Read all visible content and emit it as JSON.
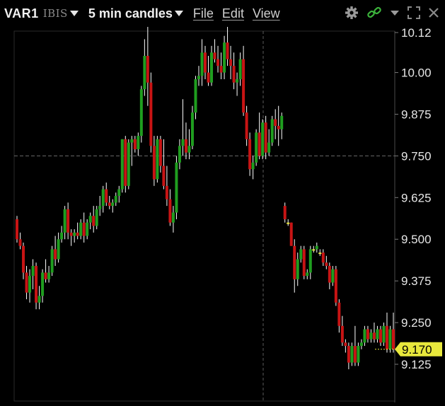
{
  "header": {
    "symbol": "VAR1",
    "exchange": "IBIS",
    "interval_label": "5 min candles",
    "menu": [
      "File",
      "Edit",
      "View"
    ]
  },
  "toolbar_icons": [
    "gear-icon",
    "link-icon",
    "dropdown-caret-icon",
    "expand-icon",
    "close-icon"
  ],
  "colors": {
    "background": "#000000",
    "up": "#1f9e1f",
    "down": "#c81414",
    "wick": "#ffffff",
    "last_price_badge": "#e8e83c",
    "accent_link": "#3cb43c"
  },
  "chart_data": {
    "type": "candlestick",
    "y_ticks": [
      "10.12",
      "10.00",
      "9.875",
      "9.750",
      "9.625",
      "9.500",
      "9.375",
      "9.250",
      "9.125"
    ],
    "ylim": [
      9.1,
      10.18
    ],
    "last_price": "9.170",
    "crosshair_price": 9.75,
    "candles": [
      [
        9.56,
        9.57,
        9.49,
        9.5
      ],
      [
        9.5,
        9.52,
        9.47,
        9.48
      ],
      [
        9.48,
        9.49,
        9.38,
        9.4
      ],
      [
        9.4,
        9.42,
        9.32,
        9.34
      ],
      [
        9.34,
        9.41,
        9.31,
        9.39
      ],
      [
        9.39,
        9.44,
        9.35,
        9.42
      ],
      [
        9.42,
        9.43,
        9.29,
        9.31
      ],
      [
        9.31,
        9.36,
        9.29,
        9.33
      ],
      [
        9.33,
        9.41,
        9.31,
        9.4
      ],
      [
        9.4,
        9.44,
        9.37,
        9.38
      ],
      [
        9.38,
        9.42,
        9.37,
        9.4
      ],
      [
        9.4,
        9.48,
        9.39,
        9.47
      ],
      [
        9.47,
        9.51,
        9.42,
        9.44
      ],
      [
        9.44,
        9.52,
        9.43,
        9.5
      ],
      [
        9.5,
        9.54,
        9.49,
        9.52
      ],
      [
        9.52,
        9.6,
        9.5,
        9.59
      ],
      [
        9.59,
        9.61,
        9.5,
        9.52
      ],
      [
        9.52,
        9.53,
        9.48,
        9.51
      ],
      [
        9.51,
        9.53,
        9.49,
        9.52
      ],
      [
        9.52,
        9.55,
        9.5,
        9.51
      ],
      [
        9.51,
        9.56,
        9.5,
        9.55
      ],
      [
        9.55,
        9.58,
        9.49,
        9.51
      ],
      [
        9.51,
        9.56,
        9.5,
        9.55
      ],
      [
        9.55,
        9.58,
        9.53,
        9.57
      ],
      [
        9.57,
        9.6,
        9.52,
        9.54
      ],
      [
        9.54,
        9.6,
        9.53,
        9.59
      ],
      [
        9.59,
        9.63,
        9.57,
        9.6
      ],
      [
        9.6,
        9.66,
        9.58,
        9.65
      ],
      [
        9.65,
        9.67,
        9.6,
        9.61
      ],
      [
        9.61,
        9.63,
        9.59,
        9.6
      ],
      [
        9.6,
        9.62,
        9.58,
        9.61
      ],
      [
        9.61,
        9.64,
        9.6,
        9.63
      ],
      [
        9.63,
        9.66,
        9.61,
        9.65
      ],
      [
        9.65,
        9.8,
        9.64,
        9.8
      ],
      [
        9.8,
        9.81,
        9.64,
        9.66
      ],
      [
        9.66,
        9.8,
        9.65,
        9.79
      ],
      [
        9.79,
        9.81,
        9.72,
        9.8
      ],
      [
        9.8,
        9.81,
        9.76,
        9.77
      ],
      [
        9.77,
        9.82,
        9.75,
        9.81
      ],
      [
        9.81,
        9.96,
        9.79,
        9.95
      ],
      [
        9.95,
        10.1,
        9.93,
        10.05
      ],
      [
        10.05,
        10.15,
        9.9,
        9.97
      ],
      [
        9.97,
        10.0,
        9.76,
        9.78
      ],
      [
        9.78,
        9.81,
        9.66,
        9.68
      ],
      [
        9.68,
        9.81,
        9.67,
        9.8
      ],
      [
        9.8,
        9.81,
        9.7,
        9.72
      ],
      [
        9.72,
        9.8,
        9.65,
        9.66
      ],
      [
        9.66,
        9.72,
        9.6,
        9.62
      ],
      [
        9.62,
        9.65,
        9.54,
        9.55
      ],
      [
        9.55,
        9.6,
        9.52,
        9.58
      ],
      [
        9.58,
        9.75,
        9.56,
        9.73
      ],
      [
        9.73,
        9.8,
        9.71,
        9.78
      ],
      [
        9.78,
        9.92,
        9.75,
        9.8
      ],
      [
        9.8,
        9.85,
        9.74,
        9.76
      ],
      [
        9.76,
        9.83,
        9.74,
        9.78
      ],
      [
        9.78,
        9.9,
        9.77,
        9.88
      ],
      [
        9.88,
        9.99,
        9.86,
        9.98
      ],
      [
        9.98,
        10.02,
        9.96,
        9.99
      ],
      [
        9.99,
        10.1,
        9.96,
        10.06
      ],
      [
        10.06,
        10.08,
        9.98,
        10.0
      ],
      [
        10.0,
        10.05,
        9.96,
        9.97
      ],
      [
        9.97,
        10.08,
        9.96,
        10.06
      ],
      [
        10.06,
        10.1,
        10.03,
        10.04
      ],
      [
        10.04,
        10.08,
        10.0,
        10.02
      ],
      [
        10.02,
        10.06,
        9.98,
        10.0
      ],
      [
        10.0,
        10.11,
        9.98,
        10.09
      ],
      [
        10.09,
        10.14,
        10.02,
        10.04
      ],
      [
        10.04,
        10.08,
        9.98,
        10.02
      ],
      [
        10.02,
        10.06,
        9.95,
        9.97
      ],
      [
        9.97,
        10.0,
        9.93,
        9.98
      ],
      [
        9.98,
        10.06,
        9.96,
        10.04
      ],
      [
        10.04,
        10.08,
        9.87,
        9.88
      ],
      [
        9.88,
        9.9,
        9.78,
        9.8
      ],
      [
        9.8,
        9.82,
        9.69,
        9.71
      ],
      [
        9.71,
        9.75,
        9.68,
        9.73
      ],
      [
        9.73,
        9.83,
        9.72,
        9.82
      ],
      [
        9.82,
        9.88,
        9.74,
        9.75
      ],
      [
        9.75,
        9.86,
        9.74,
        9.85
      ],
      [
        9.85,
        9.87,
        9.74,
        9.76
      ],
      [
        9.76,
        9.83,
        9.75,
        9.79
      ],
      [
        9.79,
        9.87,
        9.78,
        9.86
      ],
      [
        9.86,
        9.89,
        9.8,
        9.84
      ],
      [
        9.84,
        9.9,
        9.78,
        9.83
      ],
      [
        9.83,
        9.88,
        9.8,
        9.87
      ],
      [
        9.6,
        9.61,
        9.55,
        9.56
      ],
      [
        9.55,
        9.56,
        9.54,
        9.55
      ],
      [
        9.55,
        9.55,
        9.48,
        9.48
      ],
      [
        9.48,
        9.5,
        9.34,
        9.38
      ],
      [
        9.38,
        9.46,
        9.36,
        9.44
      ],
      [
        9.44,
        9.48,
        9.43,
        9.47
      ],
      [
        9.47,
        9.48,
        9.38,
        9.39
      ],
      [
        9.39,
        9.41,
        9.38,
        9.4
      ],
      [
        9.4,
        9.48,
        9.38,
        9.47
      ],
      [
        9.47,
        9.48,
        9.46,
        9.47
      ],
      [
        9.47,
        9.49,
        9.46,
        9.48
      ],
      [
        9.46,
        9.47,
        9.45,
        9.46
      ],
      [
        9.46,
        9.47,
        9.42,
        9.43
      ],
      [
        9.43,
        9.45,
        9.41,
        9.42
      ],
      [
        9.42,
        9.43,
        9.35,
        9.37
      ],
      [
        9.37,
        9.42,
        9.36,
        9.41
      ],
      [
        9.41,
        9.42,
        9.3,
        9.31
      ],
      [
        9.31,
        9.32,
        9.22,
        9.24
      ],
      [
        9.24,
        9.27,
        9.18,
        9.19
      ],
      [
        9.19,
        9.2,
        9.16,
        9.18
      ],
      [
        9.18,
        9.19,
        9.11,
        9.13
      ],
      [
        9.13,
        9.19,
        9.12,
        9.18
      ],
      [
        9.18,
        9.24,
        9.12,
        9.13
      ],
      [
        9.13,
        9.19,
        9.12,
        9.18
      ],
      [
        9.18,
        9.2,
        9.17,
        9.19
      ],
      [
        9.19,
        9.24,
        9.18,
        9.23
      ],
      [
        9.23,
        9.24,
        9.19,
        9.2
      ],
      [
        9.2,
        9.23,
        9.19,
        9.22
      ],
      [
        9.22,
        9.25,
        9.19,
        9.2
      ],
      [
        9.2,
        9.24,
        9.19,
        9.23
      ],
      [
        9.23,
        9.24,
        9.18,
        9.19
      ],
      [
        9.19,
        9.25,
        9.18,
        9.24
      ],
      [
        9.24,
        9.28,
        9.16,
        9.17
      ],
      [
        9.17,
        9.24,
        9.16,
        9.23
      ],
      [
        9.23,
        9.28,
        9.16,
        9.17
      ]
    ]
  }
}
